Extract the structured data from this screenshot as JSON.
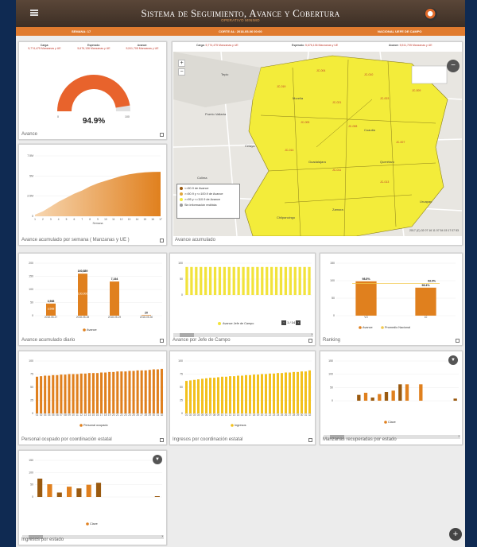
{
  "header": {
    "title": "Sistema de Seguimiento, Avance y Cobertura",
    "subtitle": "OPERATIVO MINIMO",
    "week": "SEMANA: 17",
    "cutoff": "CORTE AL: 2018-05-06 00:00",
    "role": "NACIONAL UEFE DE CAMPO"
  },
  "colors": {
    "accent": "#e07b2f",
    "header_bg": "#3d2f25",
    "map_fill": "#f3ec3a",
    "bar": "#e0801e",
    "bar_dark": "#9a5a10",
    "bar_yellow": "#f2e33b"
  },
  "stats": {
    "carga_label": "Carga:",
    "carga_value": "5,774,475 Manzanas y UE",
    "esperado_label": "Esperado:",
    "esperado_value": "5,676,136 Manzanas y UE",
    "avance_label": "Avance:",
    "avance_value": "5,511,705 Manzanas y UE"
  },
  "gauge": {
    "title": "Avance",
    "value": "94.9%",
    "min_label": "0",
    "max_label": "100",
    "chart_data": {
      "type": "gauge",
      "value": 94.9,
      "min": 0,
      "max": 100
    }
  },
  "map": {
    "title": "Avance acumulado",
    "zoom_in": "+",
    "zoom_out": "−",
    "legend": [
      {
        "label": "<=50.9 de Avance",
        "color": "#9a5a10"
      },
      {
        "label": ">=50.9 y <=100.9 de Avance",
        "color": "#e0a63a"
      },
      {
        "label": ">=95 y <=110.9 de Avance",
        "color": "#f3ec3a"
      },
      {
        "label": "Sin información recibida",
        "color": "#999999"
      }
    ],
    "places": [
      "Puerto Vallarta",
      "Tepic",
      "Guadalajara",
      "Colima",
      "Morelia",
      "Querétaro",
      "Zamora",
      "Celaya",
      "Cuautla",
      "Zitácuaro",
      "Uruapan",
      "Chilpancingo"
    ],
    "districts": [
      "JC-004",
      "JC-010",
      "JC-009",
      "JC-019",
      "JC-021",
      "JC-003",
      "JC-005",
      "JC-008",
      "JC-007",
      "JC-014",
      "JC-011",
      "JC-013"
    ],
    "attribution": "2017 (C) 02 07 16 11 07 54 15 17 07 53"
  },
  "chart_data": [
    {
      "type": "area",
      "title": "Avance acumulado por semana ( Manzanas y UE )",
      "xlabel": "Semana",
      "y_ticks": [
        "7.5M",
        "5M",
        "2.5M",
        "0"
      ],
      "categories": [
        "1",
        "2",
        "3",
        "4",
        "5",
        "6",
        "7",
        "8",
        "9",
        "10",
        "11",
        "12",
        "13",
        "14",
        "15",
        "16",
        "17"
      ],
      "values": [
        0.2,
        0.6,
        1.2,
        1.8,
        2.3,
        2.8,
        3.2,
        3.7,
        4.1,
        4.4,
        4.7,
        5.0,
        5.2,
        5.35,
        5.45,
        5.5,
        5.51
      ],
      "ylim": [
        0,
        7.5
      ]
    },
    {
      "type": "bar",
      "title": "Avance acumulado diario",
      "categories": [
        "2018-05-27",
        "2018-05-28",
        "2018-05-29",
        "2018-05-30"
      ],
      "values": [
        46,
        160,
        130,
        2
      ],
      "data_labels": [
        "3,568",
        "160,889",
        "7,164",
        "20"
      ],
      "inner_labels": [
        "3,568",
        "130,000",
        "",
        ""
      ],
      "y_ticks": [
        "200",
        "150",
        "100",
        "50",
        "0"
      ],
      "legend": "Avance",
      "ylim": [
        0,
        200
      ]
    },
    {
      "type": "bar",
      "title": "Avance por Jefe de Campo",
      "values": [
        88,
        88,
        88,
        88,
        88,
        88,
        88,
        88,
        88,
        88,
        88,
        88,
        88,
        88,
        88,
        88,
        88,
        88,
        88,
        88,
        88,
        88,
        88,
        88,
        88,
        88,
        88
      ],
      "y_ticks": [
        "100",
        "50",
        "0"
      ],
      "legend": "Avance Jefe de Campo",
      "pager": "1 / 14",
      "footer": "Avance por Jefe de Campo",
      "ylim": [
        0,
        100
      ]
    },
    {
      "type": "bar",
      "title": "Ranking",
      "categories": [
        "VO",
        "10"
      ],
      "values": [
        98,
        80
      ],
      "data_labels": [
        "98.8%",
        "98.4%"
      ],
      "target": 92,
      "target_label": "93.0%",
      "y_ticks": [
        "150",
        "100",
        "50",
        "0"
      ],
      "legend": [
        "Avance",
        "Promedio Nacional"
      ],
      "ylim": [
        0,
        150
      ]
    },
    {
      "type": "bar",
      "title": "Personal ocupado por coordinación estatal",
      "categories": [
        "01",
        "02",
        "03",
        "04",
        "05",
        "06",
        "07",
        "08",
        "09",
        "10",
        "11",
        "12",
        "13",
        "14",
        "15",
        "16",
        "17",
        "18",
        "19",
        "20",
        "21",
        "22",
        "23",
        "24",
        "25",
        "26",
        "27",
        "28",
        "29",
        "30",
        "31",
        "32"
      ],
      "values": [
        70,
        71,
        72,
        72,
        73,
        73,
        74,
        74,
        75,
        75,
        75,
        76,
        76,
        77,
        77,
        77,
        78,
        78,
        79,
        79,
        80,
        80,
        80,
        81,
        81,
        82,
        82,
        82,
        83,
        84,
        84,
        85
      ],
      "y_ticks": [
        "100",
        "75",
        "50",
        "25",
        "0"
      ],
      "legend": "Personal ocupado",
      "ylim": [
        0,
        100
      ]
    },
    {
      "type": "bar",
      "title": "Ingresos por coordinación estatal",
      "categories": [
        "01",
        "02",
        "03",
        "04",
        "05",
        "06",
        "07",
        "08",
        "09",
        "10",
        "11",
        "12",
        "13",
        "14",
        "15",
        "16",
        "17",
        "18",
        "19",
        "20",
        "21",
        "22",
        "23",
        "24",
        "25",
        "26",
        "27",
        "28",
        "29",
        "30",
        "31",
        "32"
      ],
      "values": [
        62,
        63,
        64,
        65,
        66,
        67,
        68,
        68,
        69,
        70,
        70,
        71,
        71,
        72,
        72,
        73,
        73,
        74,
        74,
        75,
        75,
        76,
        76,
        77,
        77,
        78,
        78,
        79,
        79,
        80,
        80,
        82
      ],
      "y_ticks": [
        "100",
        "75",
        "50",
        "25",
        "0"
      ],
      "legend": "Ingresos",
      "ylim": [
        0,
        100
      ]
    },
    {
      "type": "bar",
      "title": "Manzanas recuperadas por estado",
      "values": [
        0,
        0,
        0,
        22,
        30,
        12,
        25,
        33,
        38,
        62,
        62,
        0,
        62,
        0,
        0,
        0,
        0,
        8
      ],
      "y_ticks": [
        "150",
        "100",
        "50",
        "0"
      ],
      "legend": "Clave",
      "ylim": [
        0,
        150
      ]
    },
    {
      "type": "bar",
      "title": "Ingresos por estado",
      "values": [
        75,
        52,
        18,
        42,
        35,
        50,
        58,
        0,
        0,
        0,
        0,
        0,
        3
      ],
      "y_ticks": [
        "150",
        "100",
        "50",
        "0"
      ],
      "legend": "Clave",
      "ylim": [
        0,
        150
      ]
    }
  ],
  "fab": "+"
}
